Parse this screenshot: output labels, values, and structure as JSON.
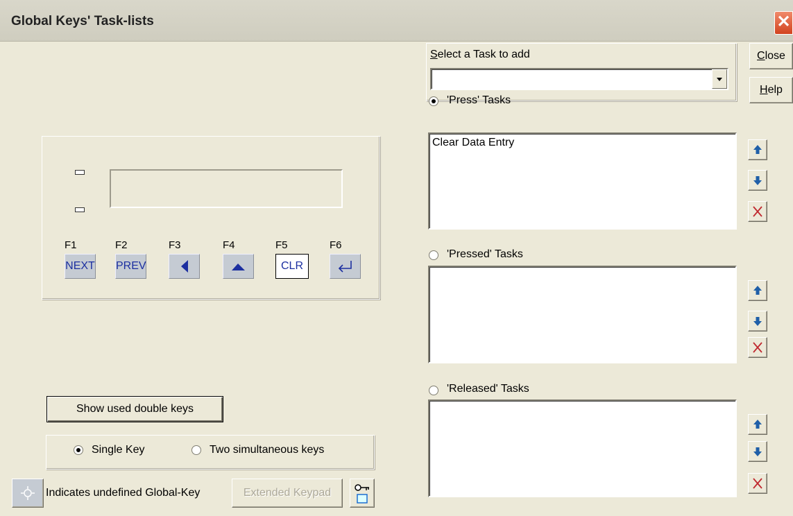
{
  "window": {
    "title": "Global Keys' Task-lists",
    "close_glyph": "✕"
  },
  "task_select": {
    "label": "Select a Task to add",
    "value": ""
  },
  "buttons": {
    "close": "Close",
    "help": "Help"
  },
  "press": {
    "label": "'Press' Tasks",
    "selected": true,
    "items": [
      "Clear Data Entry"
    ]
  },
  "pressed": {
    "label": "'Pressed' Tasks",
    "selected": false,
    "items": []
  },
  "released": {
    "label": "'Released' Tasks",
    "selected": false,
    "items": []
  },
  "keypad": {
    "keys": [
      {
        "fn": "F1",
        "label": "NEXT"
      },
      {
        "fn": "F2",
        "label": "PREV"
      },
      {
        "fn": "F3",
        "label": "",
        "icon": "left-arrow-icon"
      },
      {
        "fn": "F4",
        "label": "",
        "icon": "up-arrow-icon"
      },
      {
        "fn": "F5",
        "label": "CLR"
      },
      {
        "fn": "F6",
        "label": "",
        "icon": "enter-arrow-icon"
      }
    ]
  },
  "show_double_keys": "Show used double keys",
  "mode": {
    "single": "Single Key",
    "two": "Two simultaneous keys",
    "selected": "single"
  },
  "legend": {
    "text": "Indicates undefined Global-Key"
  },
  "extended_keypad": "Extended Keypad",
  "colors": {
    "key_face": "#c5cbd3",
    "key_text": "#1c2fa0",
    "move_arrow": "#1f5fa8",
    "delete_x": "#c0282e"
  }
}
